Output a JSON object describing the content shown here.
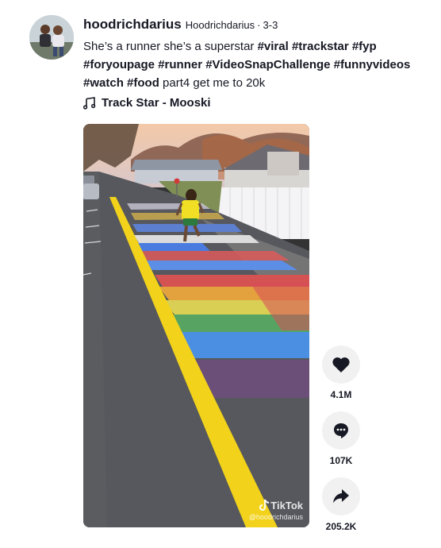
{
  "post": {
    "username": "hoodrichdarius",
    "nickname": "Hoodrichdarius",
    "separator": "·",
    "date": "3-3",
    "caption_text_1": "She’s a runner she’s a superstar ",
    "caption_tags_a": [
      "#viral",
      "#trackstar",
      "#fyp",
      "#foryoupage",
      "#runner",
      "#VideoSnapChallenge",
      "#funnyvideos",
      "#watch",
      "#food"
    ],
    "caption_text_2": "part4 get me to 20k",
    "music": "Track Star - Mooski"
  },
  "video": {
    "watermark_brand": "TikTok",
    "watermark_handle": "@hoodrichdarius"
  },
  "actions": {
    "likes": "4.1M",
    "comments": "107K",
    "shares": "205.2K"
  },
  "icons": {
    "like": "heart-icon",
    "comment": "comment-icon",
    "share": "share-arrow-icon",
    "music": "music-note-icon",
    "brand": "tiktok-logo-icon"
  },
  "colors": {
    "road_line": "#f2d21a",
    "text": "#161823",
    "action_bg": "#f1f1f2"
  }
}
